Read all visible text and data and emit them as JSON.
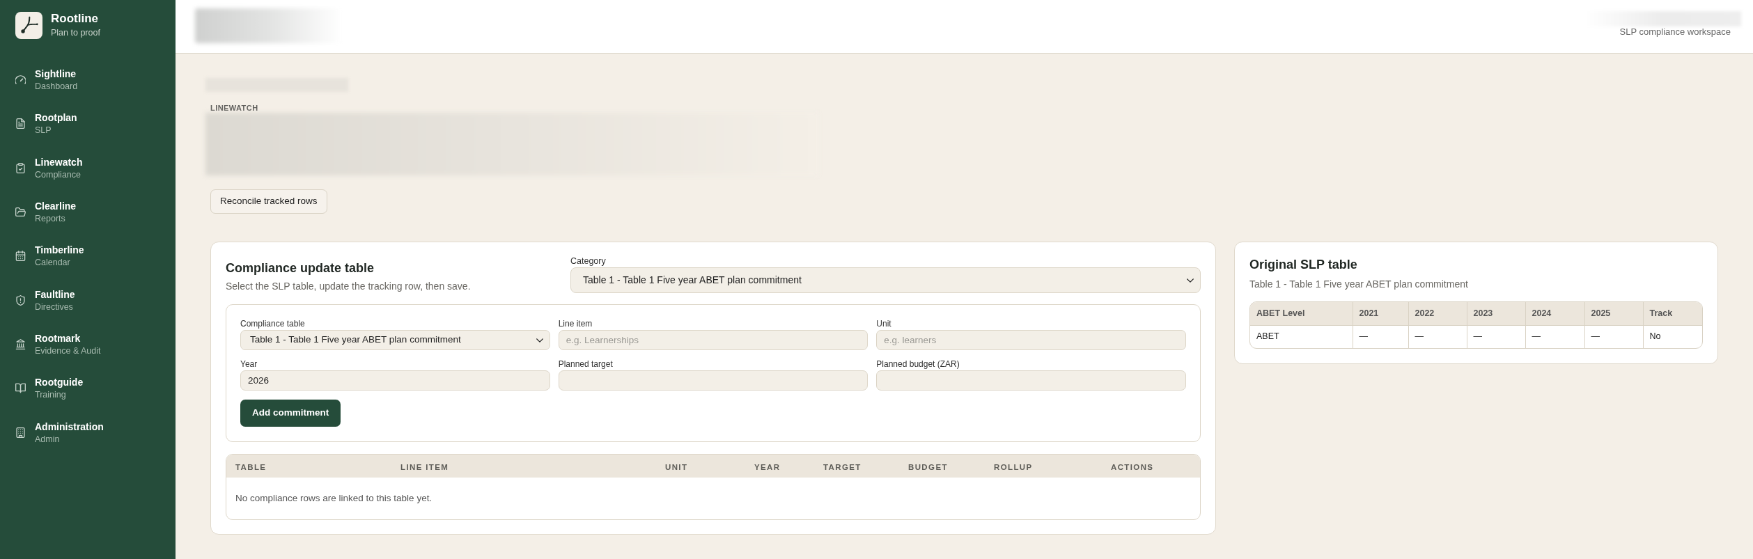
{
  "sidebar": {
    "brand": {
      "name": "Rootline",
      "tagline": "Plan to proof"
    },
    "items": [
      {
        "label": "Sightline",
        "sublabel": "Dashboard"
      },
      {
        "label": "Rootplan",
        "sublabel": "SLP"
      },
      {
        "label": "Linewatch",
        "sublabel": "Compliance"
      },
      {
        "label": "Clearline",
        "sublabel": "Reports"
      },
      {
        "label": "Timberline",
        "sublabel": "Calendar"
      },
      {
        "label": "Faultline",
        "sublabel": "Directives"
      },
      {
        "label": "Rootmark",
        "sublabel": "Evidence & Audit"
      },
      {
        "label": "Rootguide",
        "sublabel": "Training"
      },
      {
        "label": "Administration",
        "sublabel": "Admin"
      }
    ]
  },
  "header": {
    "workspace": "SLP compliance workspace"
  },
  "page": {
    "eyebrow": "LINEWATCH",
    "action_button": "Reconcile tracked rows"
  },
  "update_card": {
    "title": "Compliance update table",
    "description": "Select the SLP table, update the tracking row, then save.",
    "category": {
      "label": "Category",
      "value": "Table 1 - Table 1 Five year ABET plan commitment"
    },
    "form": {
      "fields": [
        {
          "kind": "select",
          "label": "Compliance table",
          "value": "Table 1 - Table 1 Five year ABET plan commitment"
        },
        {
          "kind": "input",
          "label": "Line item",
          "placeholder": "e.g. Learnerships"
        },
        {
          "kind": "input",
          "label": "Unit",
          "placeholder": "e.g. learners"
        },
        {
          "kind": "input",
          "label": "Year",
          "value": "2026"
        },
        {
          "kind": "input",
          "label": "Planned target"
        },
        {
          "kind": "input",
          "label": "Planned budget (ZAR)"
        }
      ],
      "submit": "Add commitment"
    },
    "table": {
      "columns": [
        "TABLE",
        "LINE ITEM",
        "UNIT",
        "YEAR",
        "TARGET",
        "BUDGET",
        "ROLLUP",
        "ACTIONS"
      ],
      "empty_message": "No compliance rows are linked to this table yet."
    }
  },
  "original_card": {
    "title": "Original SLP table",
    "subtitle": "Table 1 - Table 1 Five year ABET plan commitment",
    "table": {
      "columns": [
        "ABET Level",
        "2021",
        "2022",
        "2023",
        "2024",
        "2025",
        "Track"
      ],
      "rows": [
        [
          "ABET",
          "—",
          "—",
          "—",
          "—",
          "—",
          "No"
        ]
      ]
    }
  }
}
